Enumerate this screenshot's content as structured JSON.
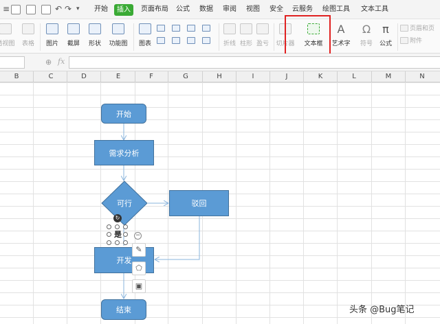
{
  "menu": {
    "tabs": [
      {
        "label": "开始"
      },
      {
        "label": "插入"
      },
      {
        "label": "页面布局"
      },
      {
        "label": "公式"
      },
      {
        "label": "数据"
      },
      {
        "label": "审阅"
      },
      {
        "label": "视图"
      },
      {
        "label": "安全"
      },
      {
        "label": "云服务"
      },
      {
        "label": "绘图工具"
      },
      {
        "label": "文本工具"
      }
    ],
    "active_tab": "插入",
    "accent_color": "#3aaa35"
  },
  "ribbon": {
    "left_cut": [
      "透视图",
      "表格"
    ],
    "picture": "图片",
    "screenshot": "截屏",
    "shape": "形状",
    "function_chart": "功能图",
    "chart": "图表",
    "line": "折线",
    "column": "柱形",
    "winloss": "盈亏",
    "slicer": "切片器",
    "textbox": "文本框",
    "wordart": "艺术字",
    "symbol": "符号",
    "formula": "公式",
    "header_footer": "页眉和页",
    "attachment": "附件",
    "highlight_color": "#e02020"
  },
  "formula_bar": {
    "fx": "fx",
    "value": ""
  },
  "columns": [
    "B",
    "C",
    "D",
    "E",
    "F",
    "G",
    "H",
    "I",
    "J",
    "K",
    "L",
    "M",
    "N"
  ],
  "flowchart": {
    "start": "开始",
    "requirements": "需求分析",
    "decision": "可行",
    "reject": "驳回",
    "develop": "开发",
    "end": "结束",
    "yes_label": "是",
    "fill_color": "#5b9bd5",
    "line_color": "#8ab4dc"
  },
  "watermark": "头条 @Bug笔记"
}
